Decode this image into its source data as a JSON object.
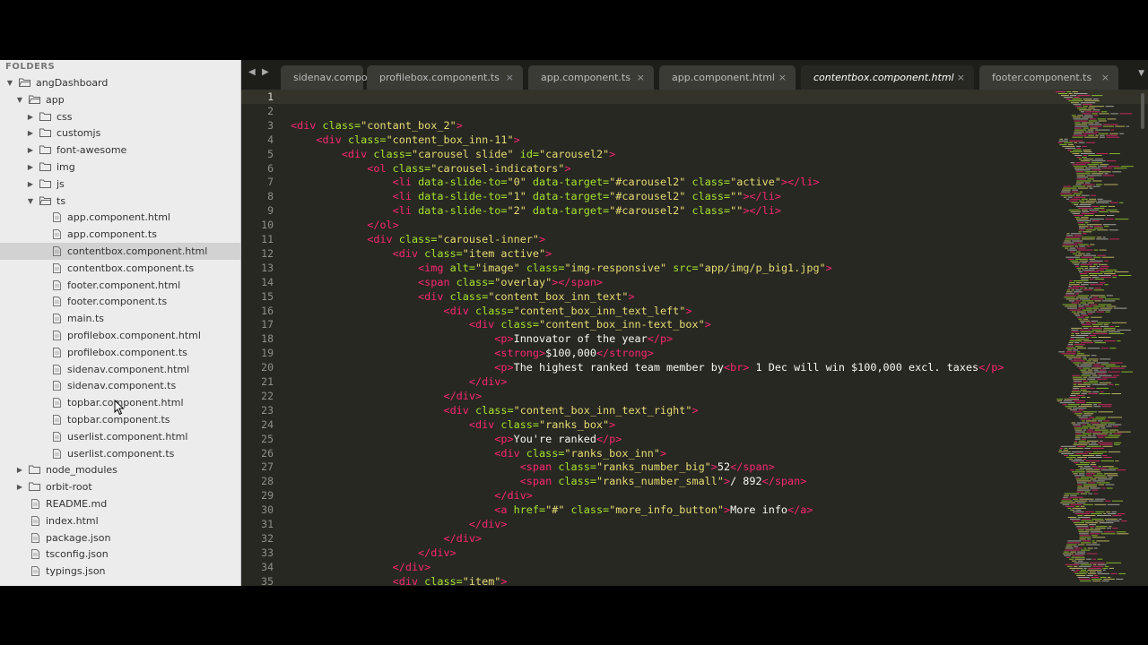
{
  "sidebar": {
    "title": "FOLDERS",
    "tree": [
      {
        "label": "angDashboard",
        "type": "folder",
        "open": true,
        "depth": 0
      },
      {
        "label": "app",
        "type": "folder",
        "open": true,
        "depth": 1
      },
      {
        "label": "css",
        "type": "folder",
        "open": false,
        "depth": 2
      },
      {
        "label": "customjs",
        "type": "folder",
        "open": false,
        "depth": 2
      },
      {
        "label": "font-awesome",
        "type": "folder",
        "open": false,
        "depth": 2
      },
      {
        "label": "img",
        "type": "folder",
        "open": false,
        "depth": 2
      },
      {
        "label": "js",
        "type": "folder",
        "open": false,
        "depth": 2
      },
      {
        "label": "ts",
        "type": "folder",
        "open": true,
        "depth": 2
      },
      {
        "label": "app.component.html",
        "type": "file",
        "depth": 3
      },
      {
        "label": "app.component.ts",
        "type": "file",
        "depth": 3
      },
      {
        "label": "contentbox.component.html",
        "type": "file",
        "depth": 3,
        "selected": true
      },
      {
        "label": "contentbox.component.ts",
        "type": "file",
        "depth": 3
      },
      {
        "label": "footer.component.html",
        "type": "file",
        "depth": 3
      },
      {
        "label": "footer.component.ts",
        "type": "file",
        "depth": 3
      },
      {
        "label": "main.ts",
        "type": "file",
        "depth": 3
      },
      {
        "label": "profilebox.component.html",
        "type": "file",
        "depth": 3
      },
      {
        "label": "profilebox.component.ts",
        "type": "file",
        "depth": 3
      },
      {
        "label": "sidenav.component.html",
        "type": "file",
        "depth": 3
      },
      {
        "label": "sidenav.component.ts",
        "type": "file",
        "depth": 3
      },
      {
        "label": "topbar.component.html",
        "type": "file",
        "depth": 3
      },
      {
        "label": "topbar.component.ts",
        "type": "file",
        "depth": 3
      },
      {
        "label": "userlist.component.html",
        "type": "file",
        "depth": 3
      },
      {
        "label": "userlist.component.ts",
        "type": "file",
        "depth": 3
      },
      {
        "label": "node_modules",
        "type": "folder",
        "open": false,
        "depth": 1
      },
      {
        "label": "orbit-root",
        "type": "folder",
        "open": false,
        "depth": 1
      },
      {
        "label": "README.md",
        "type": "file",
        "depth": 1
      },
      {
        "label": "index.html",
        "type": "file",
        "depth": 1
      },
      {
        "label": "package.json",
        "type": "file",
        "depth": 1
      },
      {
        "label": "tsconfig.json",
        "type": "file",
        "depth": 1
      },
      {
        "label": "typings.json",
        "type": "file",
        "depth": 1
      }
    ]
  },
  "tabs": [
    {
      "label": "sidenav.compor",
      "close": "",
      "active": false
    },
    {
      "label": "profilebox.component.ts",
      "close": "×",
      "active": false
    },
    {
      "label": "app.component.ts",
      "close": "×",
      "active": false
    },
    {
      "label": "app.component.html",
      "close": "×",
      "active": false
    },
    {
      "label": "contentbox.component.html",
      "close": "×",
      "active": true
    },
    {
      "label": "footer.component.ts",
      "close": "×",
      "active": false
    }
  ],
  "tab_nav": {
    "prev": "◀",
    "next": "▶",
    "menu": "▼"
  },
  "editor": {
    "current_line": 1,
    "lines": [
      [],
      [],
      [
        [
          "t",
          "<div "
        ],
        [
          "a",
          "class="
        ],
        [
          "s",
          "\"contant_box_2\""
        ],
        [
          "t",
          ">"
        ]
      ],
      [
        [
          "x",
          "    "
        ],
        [
          "t",
          "<div "
        ],
        [
          "a",
          "class="
        ],
        [
          "s",
          "\"content_box_inn-11\""
        ],
        [
          "t",
          ">"
        ]
      ],
      [
        [
          "x",
          "        "
        ],
        [
          "t",
          "<div "
        ],
        [
          "a",
          "class="
        ],
        [
          "s",
          "\"carousel slide\""
        ],
        [
          "x",
          " "
        ],
        [
          "a",
          "id="
        ],
        [
          "s",
          "\"carousel2\""
        ],
        [
          "t",
          ">"
        ]
      ],
      [
        [
          "x",
          "            "
        ],
        [
          "t",
          "<ol "
        ],
        [
          "a",
          "class="
        ],
        [
          "s",
          "\"carousel-indicators\""
        ],
        [
          "t",
          ">"
        ]
      ],
      [
        [
          "x",
          "                "
        ],
        [
          "t",
          "<li "
        ],
        [
          "a",
          "data-slide-to="
        ],
        [
          "s",
          "\"0\""
        ],
        [
          "x",
          " "
        ],
        [
          "a",
          "data-target="
        ],
        [
          "s",
          "\"#carousel2\""
        ],
        [
          "x",
          " "
        ],
        [
          "a",
          "class="
        ],
        [
          "s",
          "\"active\""
        ],
        [
          "t",
          "></li>"
        ]
      ],
      [
        [
          "x",
          "                "
        ],
        [
          "t",
          "<li "
        ],
        [
          "a",
          "data-slide-to="
        ],
        [
          "s",
          "\"1\""
        ],
        [
          "x",
          " "
        ],
        [
          "a",
          "data-target="
        ],
        [
          "s",
          "\"#carousel2\""
        ],
        [
          "x",
          " "
        ],
        [
          "a",
          "class="
        ],
        [
          "s",
          "\"\""
        ],
        [
          "t",
          "></li>"
        ]
      ],
      [
        [
          "x",
          "                "
        ],
        [
          "t",
          "<li "
        ],
        [
          "a",
          "data-slide-to="
        ],
        [
          "s",
          "\"2\""
        ],
        [
          "x",
          " "
        ],
        [
          "a",
          "data-target="
        ],
        [
          "s",
          "\"#carousel2\""
        ],
        [
          "x",
          " "
        ],
        [
          "a",
          "class="
        ],
        [
          "s",
          "\"\""
        ],
        [
          "t",
          "></li>"
        ]
      ],
      [
        [
          "x",
          "            "
        ],
        [
          "t",
          "</ol>"
        ]
      ],
      [
        [
          "x",
          "            "
        ],
        [
          "t",
          "<div "
        ],
        [
          "a",
          "class="
        ],
        [
          "s",
          "\"carousel-inner\""
        ],
        [
          "t",
          ">"
        ]
      ],
      [
        [
          "x",
          "                "
        ],
        [
          "t",
          "<div "
        ],
        [
          "a",
          "class="
        ],
        [
          "s",
          "\"item active\""
        ],
        [
          "t",
          ">"
        ]
      ],
      [
        [
          "x",
          "                    "
        ],
        [
          "t",
          "<img "
        ],
        [
          "a",
          "alt="
        ],
        [
          "s",
          "\"image\""
        ],
        [
          "x",
          " "
        ],
        [
          "a",
          "class="
        ],
        [
          "s",
          "\"img-responsive\""
        ],
        [
          "x",
          " "
        ],
        [
          "a",
          "src="
        ],
        [
          "s",
          "\"app/img/p_big1.jpg\""
        ],
        [
          "t",
          ">"
        ]
      ],
      [
        [
          "x",
          "                    "
        ],
        [
          "t",
          "<span "
        ],
        [
          "a",
          "class="
        ],
        [
          "s",
          "\"overlay\""
        ],
        [
          "t",
          "></span>"
        ]
      ],
      [
        [
          "x",
          "                    "
        ],
        [
          "t",
          "<div "
        ],
        [
          "a",
          "class="
        ],
        [
          "s",
          "\"content_box_inn_text\""
        ],
        [
          "t",
          ">"
        ]
      ],
      [
        [
          "x",
          "                        "
        ],
        [
          "t",
          "<div "
        ],
        [
          "a",
          "class="
        ],
        [
          "s",
          "\"content_box_inn_text_left\""
        ],
        [
          "t",
          ">"
        ]
      ],
      [
        [
          "x",
          "                            "
        ],
        [
          "t",
          "<div "
        ],
        [
          "a",
          "class="
        ],
        [
          "s",
          "\"content_box_inn-text_box\""
        ],
        [
          "t",
          ">"
        ]
      ],
      [
        [
          "x",
          "                                "
        ],
        [
          "t",
          "<p>"
        ],
        [
          "x",
          "Innovator of the year"
        ],
        [
          "t",
          "</p>"
        ]
      ],
      [
        [
          "x",
          "                                "
        ],
        [
          "t",
          "<strong>"
        ],
        [
          "x",
          "$100,000"
        ],
        [
          "t",
          "</strong>"
        ]
      ],
      [
        [
          "x",
          "                                "
        ],
        [
          "t",
          "<p>"
        ],
        [
          "x",
          "The highest ranked team member by"
        ],
        [
          "t",
          "<br>"
        ],
        [
          "x",
          " 1 Dec will win $100,000 excl. taxes"
        ],
        [
          "t",
          "</p>"
        ]
      ],
      [
        [
          "x",
          "                            "
        ],
        [
          "t",
          "</div>"
        ]
      ],
      [
        [
          "x",
          "                        "
        ],
        [
          "t",
          "</div>"
        ]
      ],
      [
        [
          "x",
          "                        "
        ],
        [
          "t",
          "<div "
        ],
        [
          "a",
          "class="
        ],
        [
          "s",
          "\"content_box_inn_text_right\""
        ],
        [
          "t",
          ">"
        ]
      ],
      [
        [
          "x",
          "                            "
        ],
        [
          "t",
          "<div "
        ],
        [
          "a",
          "class="
        ],
        [
          "s",
          "\"ranks_box\""
        ],
        [
          "t",
          ">"
        ]
      ],
      [
        [
          "x",
          "                                "
        ],
        [
          "t",
          "<p>"
        ],
        [
          "x",
          "You're ranked"
        ],
        [
          "t",
          "</p>"
        ]
      ],
      [
        [
          "x",
          "                                "
        ],
        [
          "t",
          "<div "
        ],
        [
          "a",
          "class="
        ],
        [
          "s",
          "\"ranks_box_inn\""
        ],
        [
          "t",
          ">"
        ]
      ],
      [
        [
          "x",
          "                                    "
        ],
        [
          "t",
          "<span "
        ],
        [
          "a",
          "class="
        ],
        [
          "s",
          "\"ranks_number_big\""
        ],
        [
          "t",
          ">"
        ],
        [
          "x",
          "52"
        ],
        [
          "t",
          "</span>"
        ]
      ],
      [
        [
          "x",
          "                                    "
        ],
        [
          "t",
          "<span "
        ],
        [
          "a",
          "class="
        ],
        [
          "s",
          "\"ranks_number_small\""
        ],
        [
          "t",
          ">"
        ],
        [
          "x",
          "/ 892"
        ],
        [
          "t",
          "</span>"
        ]
      ],
      [
        [
          "x",
          "                                "
        ],
        [
          "t",
          "</div>"
        ]
      ],
      [
        [
          "x",
          "                                "
        ],
        [
          "t",
          "<a "
        ],
        [
          "a",
          "href="
        ],
        [
          "s",
          "\"#\""
        ],
        [
          "x",
          " "
        ],
        [
          "a",
          "class="
        ],
        [
          "s",
          "\"more_info_button\""
        ],
        [
          "t",
          ">"
        ],
        [
          "x",
          "More info"
        ],
        [
          "t",
          "</a>"
        ]
      ],
      [
        [
          "x",
          "                            "
        ],
        [
          "t",
          "</div>"
        ]
      ],
      [
        [
          "x",
          "                        "
        ],
        [
          "t",
          "</div>"
        ]
      ],
      [
        [
          "x",
          "                    "
        ],
        [
          "t",
          "</div>"
        ]
      ],
      [
        [
          "x",
          "                "
        ],
        [
          "t",
          "</div>"
        ]
      ],
      [
        [
          "x",
          "                "
        ],
        [
          "t",
          "<div "
        ],
        [
          "a",
          "class="
        ],
        [
          "s",
          "\"item\""
        ],
        [
          "t",
          ">"
        ]
      ]
    ]
  },
  "colors": {
    "editor_bg": "#272822",
    "tag": "#f92672",
    "attr": "#a6e22e",
    "string": "#e6db74",
    "text": "#f8f8f2",
    "sidebar_bg": "#ececec",
    "sidebar_selected": "#d2d2d2"
  }
}
